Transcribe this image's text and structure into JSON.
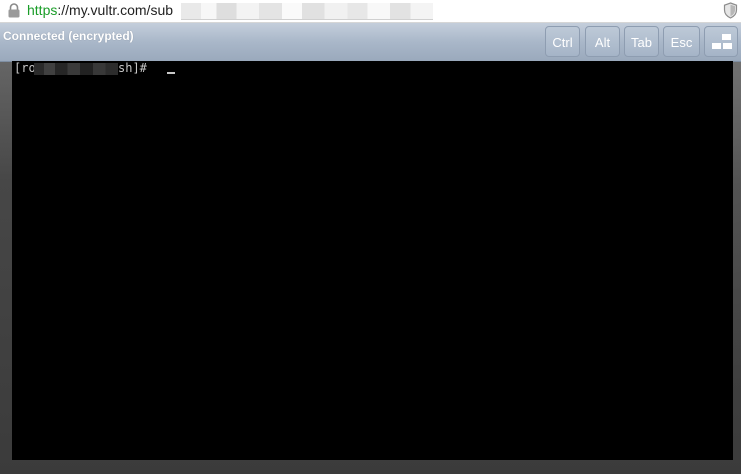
{
  "browser": {
    "url_scheme": "https",
    "url_rest": "://my.vultr.com/sub",
    "lock_icon": "lock-icon",
    "shield_icon": "shield-icon"
  },
  "console": {
    "status": "Connected (encrypted)",
    "keys": {
      "ctrl": "Ctrl",
      "alt": "Alt",
      "tab": "Tab",
      "esc": "Esc",
      "clipboard_icon": "clipboard-icon"
    }
  },
  "terminal": {
    "prompt_start": "[ro",
    "prompt_end": "sh]# ",
    "colors": {
      "background": "#000000",
      "text": "#c8c8c8"
    }
  },
  "colors": {
    "url_scheme": "#1a9d28",
    "statusbar": "#a9b7c9"
  }
}
